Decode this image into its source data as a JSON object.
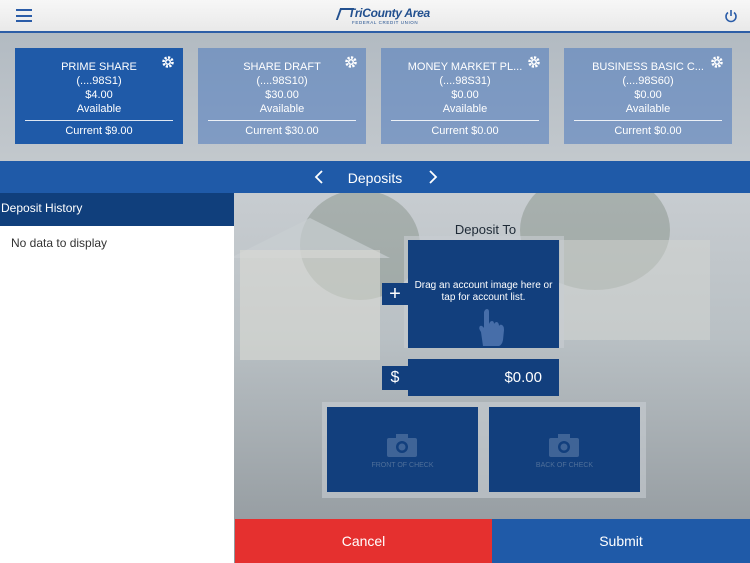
{
  "header": {
    "logo_text": "TriCounty Area",
    "logo_subtext": "FEDERAL CREDIT UNION"
  },
  "accounts": [
    {
      "name": "PRIME SHARE",
      "number": "(....98S1)",
      "balance": "$4.00",
      "status": "Available",
      "current": "Current $9.00"
    },
    {
      "name": "SHARE DRAFT",
      "number": "(....98S10)",
      "balance": "$30.00",
      "status": "Available",
      "current": "Current $30.00"
    },
    {
      "name": "MONEY MARKET PL...",
      "number": "(....98S31)",
      "balance": "$0.00",
      "status": "Available",
      "current": "Current $0.00"
    },
    {
      "name": "BUSINESS BASIC C...",
      "number": "(....98S60)",
      "balance": "$0.00",
      "status": "Available",
      "current": "Current $0.00"
    }
  ],
  "nav": {
    "title": "Deposits"
  },
  "history": {
    "heading": "Deposit History",
    "empty_text": "No data to display"
  },
  "deposit": {
    "label": "Deposit To",
    "drop_hint": "Drag an account image here or tap for account list.",
    "plus_symbol": "+",
    "currency_symbol": "$",
    "amount": "$0.00",
    "front_label": "FRONT OF CHECK",
    "back_label": "BACK OF CHECK"
  },
  "actions": {
    "cancel_label": "Cancel",
    "submit_label": "Submit"
  },
  "colors": {
    "primary_blue": "#1f5aa8",
    "dark_blue": "#123f7d",
    "cancel_red": "#e5302f"
  }
}
